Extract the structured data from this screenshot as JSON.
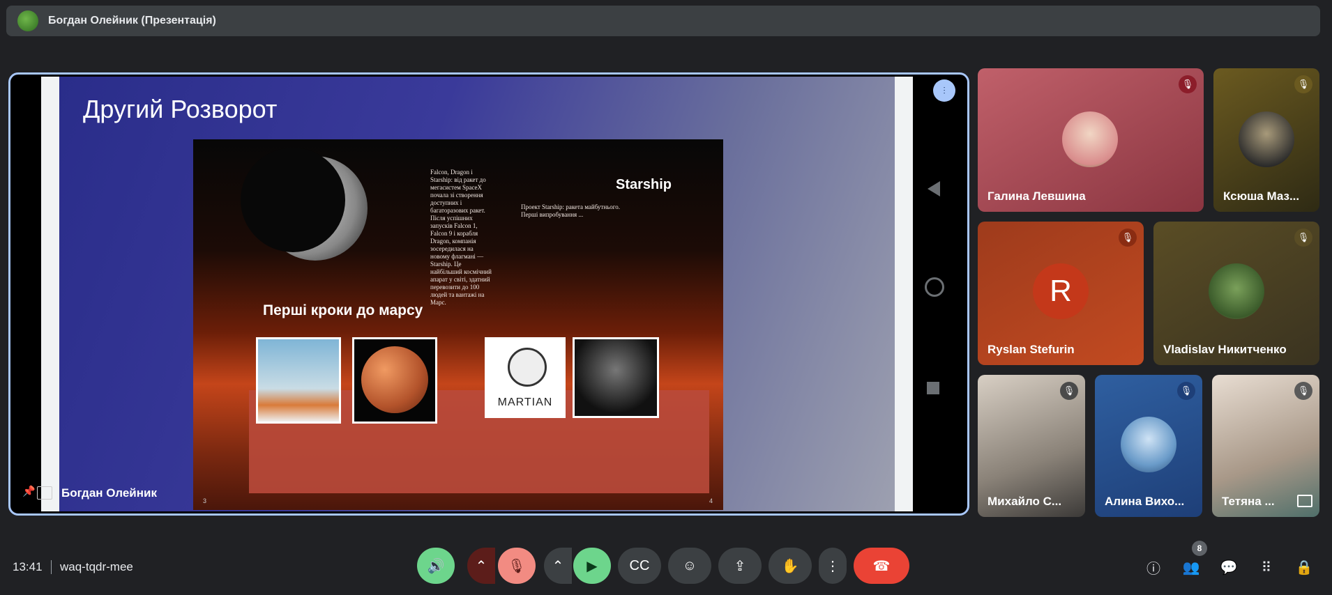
{
  "header": {
    "presentation_title": "Богдан Олейник (Презентація)"
  },
  "slide": {
    "title": "Другий Розворот",
    "heading": "Перші кроки до марсу",
    "starship": "Starship",
    "body_left": "Falcon, Dragon і Starship: від ракет до мегасистем SpaceX почала зі створення доступних і багаторазових ракет. Після успішних запусків Falcon 1, Falcon 9 і корабля Dragon, компанія зосередилася на новому флагмані — Starship. Це найбільший космічний апарат у світі, здатний перевозити до 100 людей та вантажі на Марс.",
    "body_right": "Проект Starship: ракета майбутнього. Першi випробування ...",
    "martian_label": "MARTIAN",
    "page_left": "3",
    "page_right": "4"
  },
  "presenter": {
    "name": "Богдан Олейник"
  },
  "participants": [
    {
      "name": "Галина Левшина",
      "mic": "muted"
    },
    {
      "name": "Ксюша Маз...",
      "mic": "muted"
    },
    {
      "name": "Ryslan Stefurin",
      "initial": "R",
      "mic": "muted"
    },
    {
      "name": "Vladislav Никитченко",
      "mic": "muted"
    },
    {
      "name": "Михайло С...",
      "mic": "muted"
    },
    {
      "name": "Алина Вихо...",
      "mic": "muted"
    },
    {
      "name": "Тетяна ...",
      "mic": "muted"
    }
  ],
  "bottom": {
    "time": "13:41",
    "meeting_code": "waq-tqdr-mee",
    "participants_count": "8"
  },
  "colors": {
    "accent": "#a8c7fa",
    "end_call": "#ea4335",
    "mic_off": "#f28b82",
    "camera_on": "#6dd58c"
  }
}
